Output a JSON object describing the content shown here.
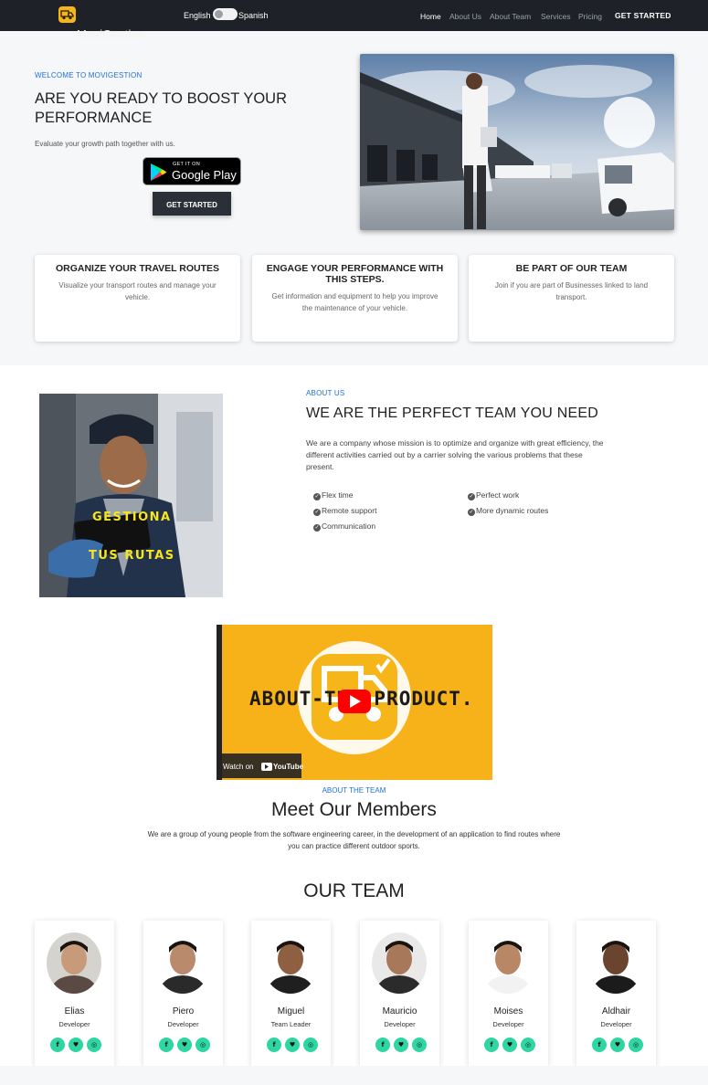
{
  "navbar": {
    "brand": "MoviGestion",
    "lang_en": "English",
    "lang_es": "Spanish",
    "links": [
      "Home",
      "About Us",
      "About Team",
      "Services",
      "Pricing"
    ],
    "cta": "GET STARTED"
  },
  "hero": {
    "eyebrow": "WELCOME TO MOVIGESTION",
    "title": "ARE YOU READY TO BOOST YOUR PERFORMANCE",
    "subtitle": "Evaluate your growth path together with us.",
    "store_small": "GET IT ON",
    "store_big": "Google Play",
    "button": "GET STARTED"
  },
  "features": [
    {
      "title": "ORGANIZE YOUR TRAVEL ROUTES",
      "desc": "Visualize your transport routes and manage your vehicle."
    },
    {
      "title": "ENGAGE YOUR PERFORMANCE WITH THIS STEPS.",
      "desc": "Get information and equipment to help you improve the maintenance of your vehicle."
    },
    {
      "title": "BE PART OF OUR TEAM",
      "desc": "Join if you are part of Businesses linked to land transport."
    }
  ],
  "about": {
    "eyebrow": "ABOUT US",
    "title": "WE ARE THE PERFECT TEAM YOU NEED",
    "desc": "We are a company whose mission is to optimize and organize with great efficiency, the different activities carried out by a carrier solving the various problems that these present.",
    "image_text_1": "GESTIONA",
    "image_text_2": "TUS RUTAS",
    "checks": [
      "Flex time",
      "Remote support",
      "Communication",
      "Perfect work",
      "More dynamic routes"
    ]
  },
  "video": {
    "banner": "ABOUT-THE PRODUCT.",
    "watch": "Watch on",
    "yt": "YouTube"
  },
  "team": {
    "eyebrow": "ABOUT THE TEAM",
    "title": "Meet Our Members",
    "desc": "We are a group of young people from the software engineering career, in the development of an application to find routes where you can practice different outdoor sports.",
    "section_title": "OUR TEAM",
    "members": [
      {
        "name": "Elias",
        "role": "Developer"
      },
      {
        "name": "Piero",
        "role": "Developer"
      },
      {
        "name": "Miguel",
        "role": "Team Leader"
      },
      {
        "name": "Mauricio",
        "role": "Developer"
      },
      {
        "name": "Moises",
        "role": "Developer"
      },
      {
        "name": "Aldhair",
        "role": "Developer"
      }
    ],
    "social_icons": [
      "facebook-icon",
      "twitter-icon",
      "instagram-icon"
    ]
  },
  "colors": {
    "nav_bg": "#1e2228",
    "accent_blue": "#1e6fd9",
    "social_green": "#2fd6a2",
    "logo_yellow": "#f6b519",
    "video_yellow": "#f7b219"
  }
}
